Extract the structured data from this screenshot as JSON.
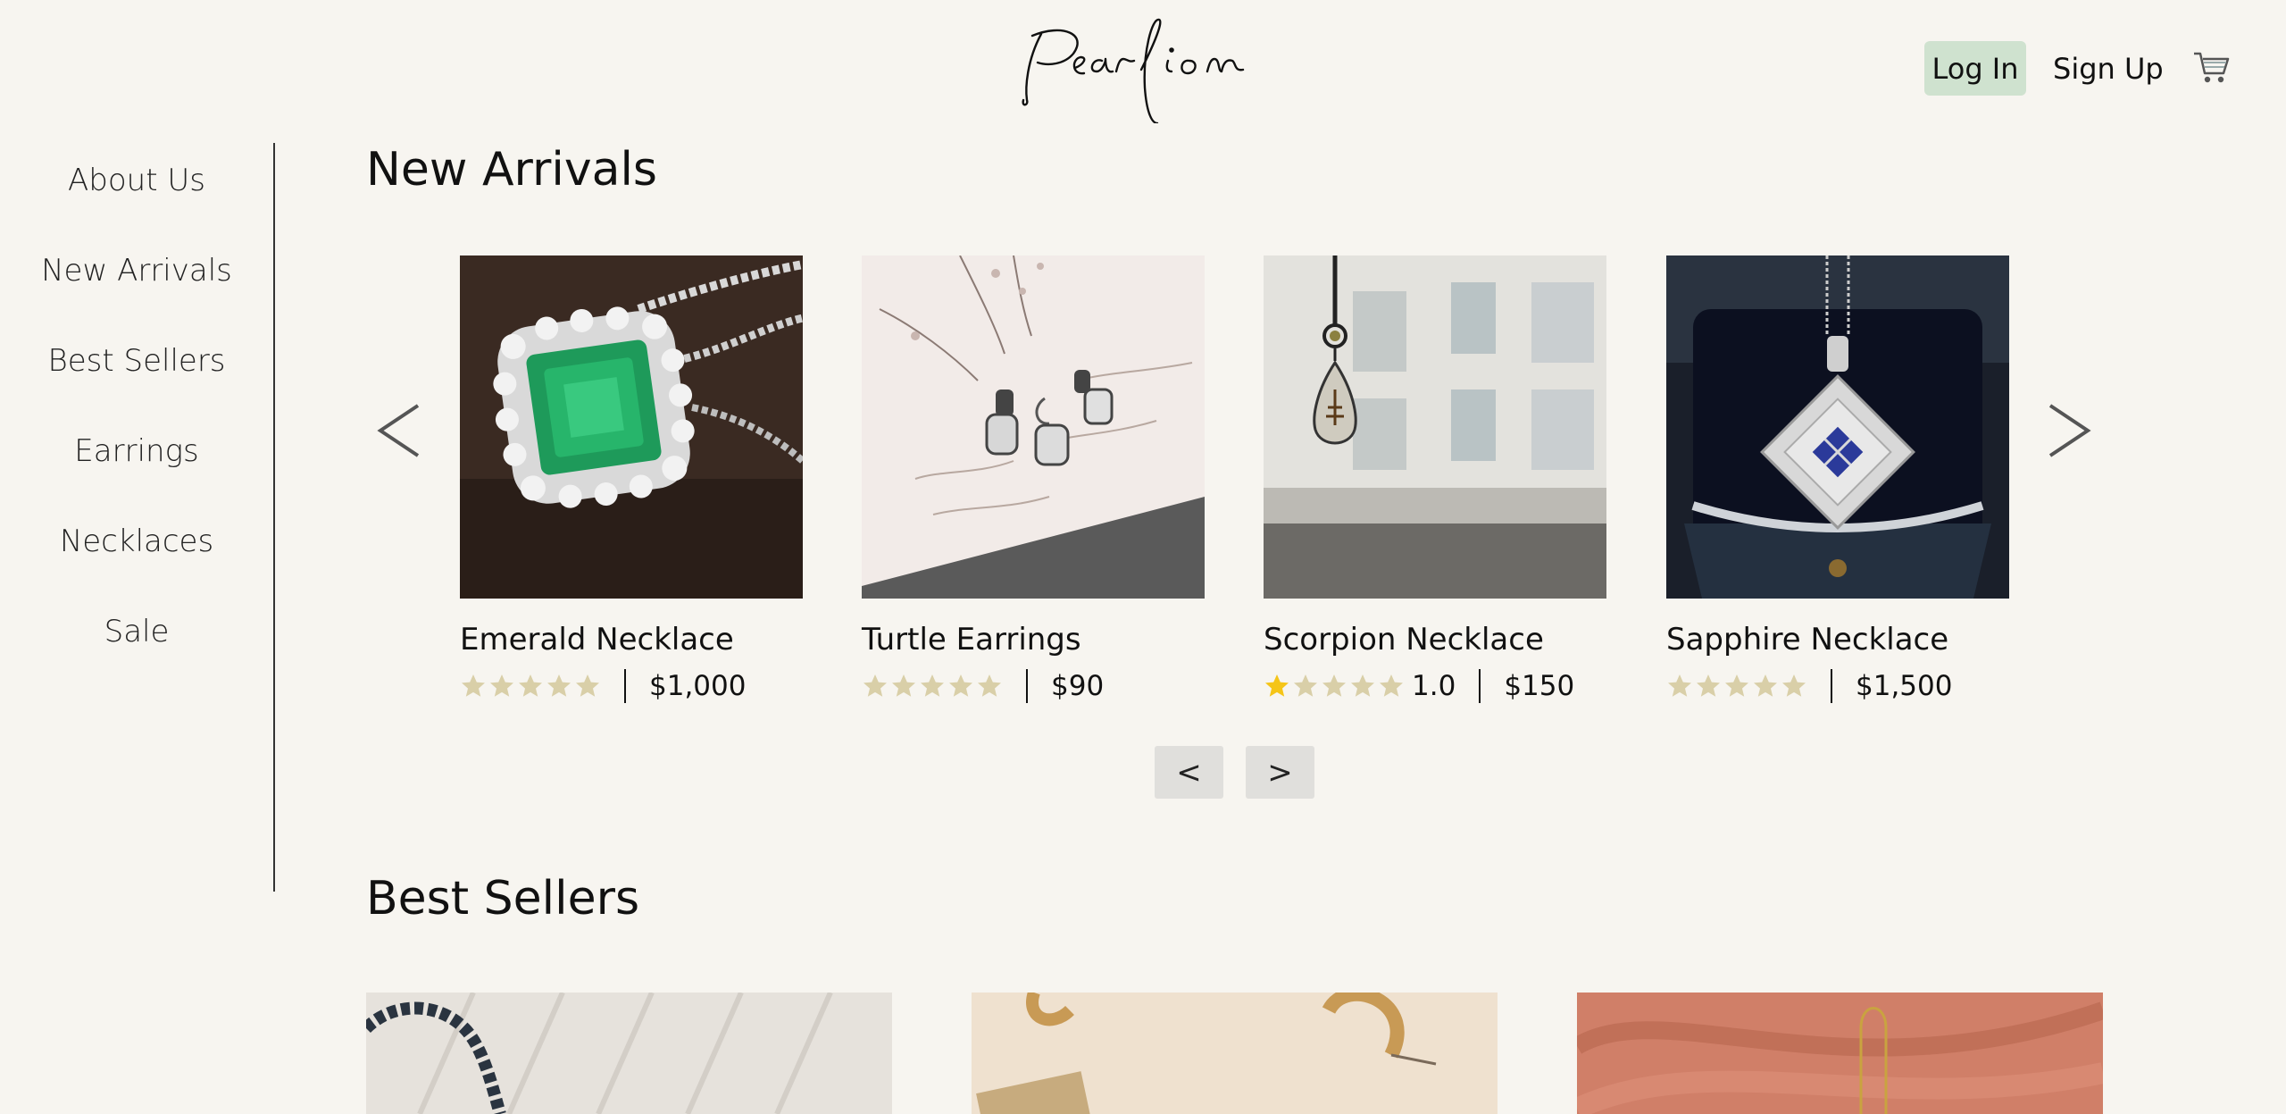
{
  "brand": {
    "name": "Pearlion"
  },
  "header": {
    "login_label": "Log In",
    "signup_label": "Sign Up",
    "cart_icon": "cart-icon",
    "accent_color": "#cfe2cf"
  },
  "sidebar": {
    "items": [
      {
        "label": "About Us"
      },
      {
        "label": "New Arrivals"
      },
      {
        "label": "Best Sellers"
      },
      {
        "label": "Earrings"
      },
      {
        "label": "Necklaces"
      },
      {
        "label": "Sale"
      }
    ]
  },
  "new_arrivals": {
    "title": "New Arrivals",
    "prev_icon": "chevron-left-icon",
    "next_icon": "chevron-right-icon",
    "products": [
      {
        "name": "Emerald Necklace",
        "price": "$1,000",
        "rating_value": 0,
        "rating_text": ""
      },
      {
        "name": "Turtle Earrings",
        "price": "$90",
        "rating_value": 0,
        "rating_text": ""
      },
      {
        "name": "Scorpion Necklace",
        "price": "$150",
        "rating_value": 1,
        "rating_text": "1.0"
      },
      {
        "name": "Sapphire Necklace",
        "price": "$1,500",
        "rating_value": 0,
        "rating_text": ""
      }
    ],
    "pager_prev": "<",
    "pager_next": ">"
  },
  "best_sellers": {
    "title": "Best Sellers"
  },
  "colors": {
    "background": "#f7f5f0",
    "star_filled": "#f5c518",
    "star_empty": "#d9cfa8"
  }
}
